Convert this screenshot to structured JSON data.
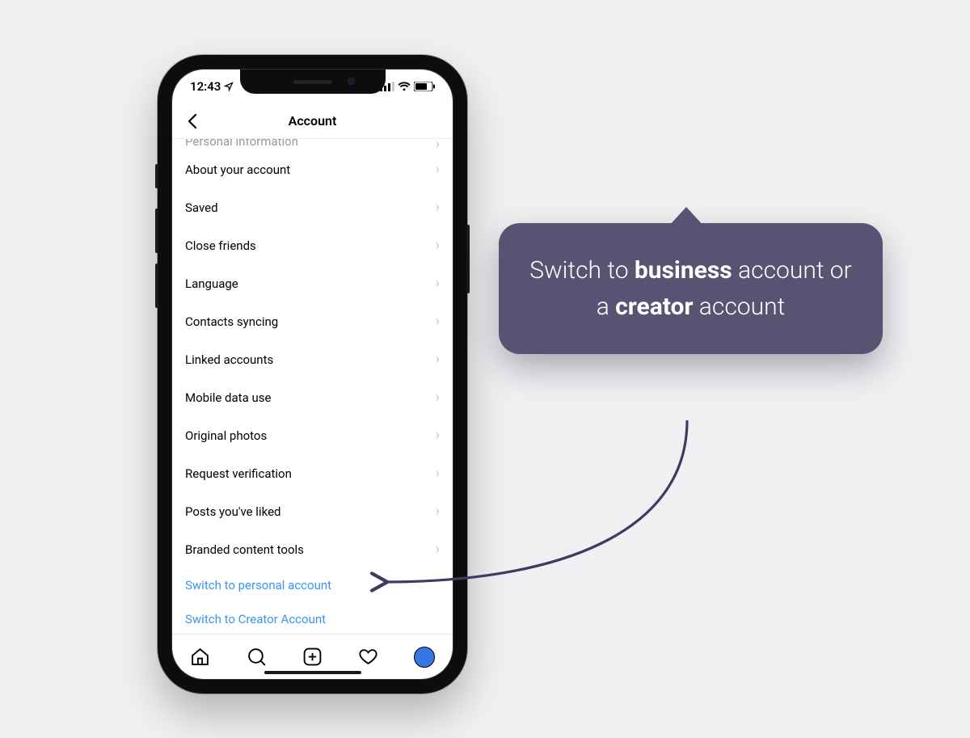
{
  "status": {
    "time": "12:43"
  },
  "header": {
    "title": "Account"
  },
  "list": {
    "rows": [
      {
        "label": "Personal information",
        "faded": true
      },
      {
        "label": "About your account"
      },
      {
        "label": "Saved"
      },
      {
        "label": "Close friends"
      },
      {
        "label": "Language"
      },
      {
        "label": "Contacts syncing"
      },
      {
        "label": "Linked accounts"
      },
      {
        "label": "Mobile data use"
      },
      {
        "label": "Original photos"
      },
      {
        "label": "Request verification"
      },
      {
        "label": "Posts you've liked"
      },
      {
        "label": "Branded content tools"
      }
    ],
    "links": [
      "Switch to personal account",
      "Switch to Creator Account"
    ]
  },
  "callout": {
    "pre": "Switch to ",
    "b1": "business",
    "mid": " account or a ",
    "b2": "creator",
    "post": " account"
  },
  "colors": {
    "accent": "#3897f0",
    "callout": "#575473"
  }
}
